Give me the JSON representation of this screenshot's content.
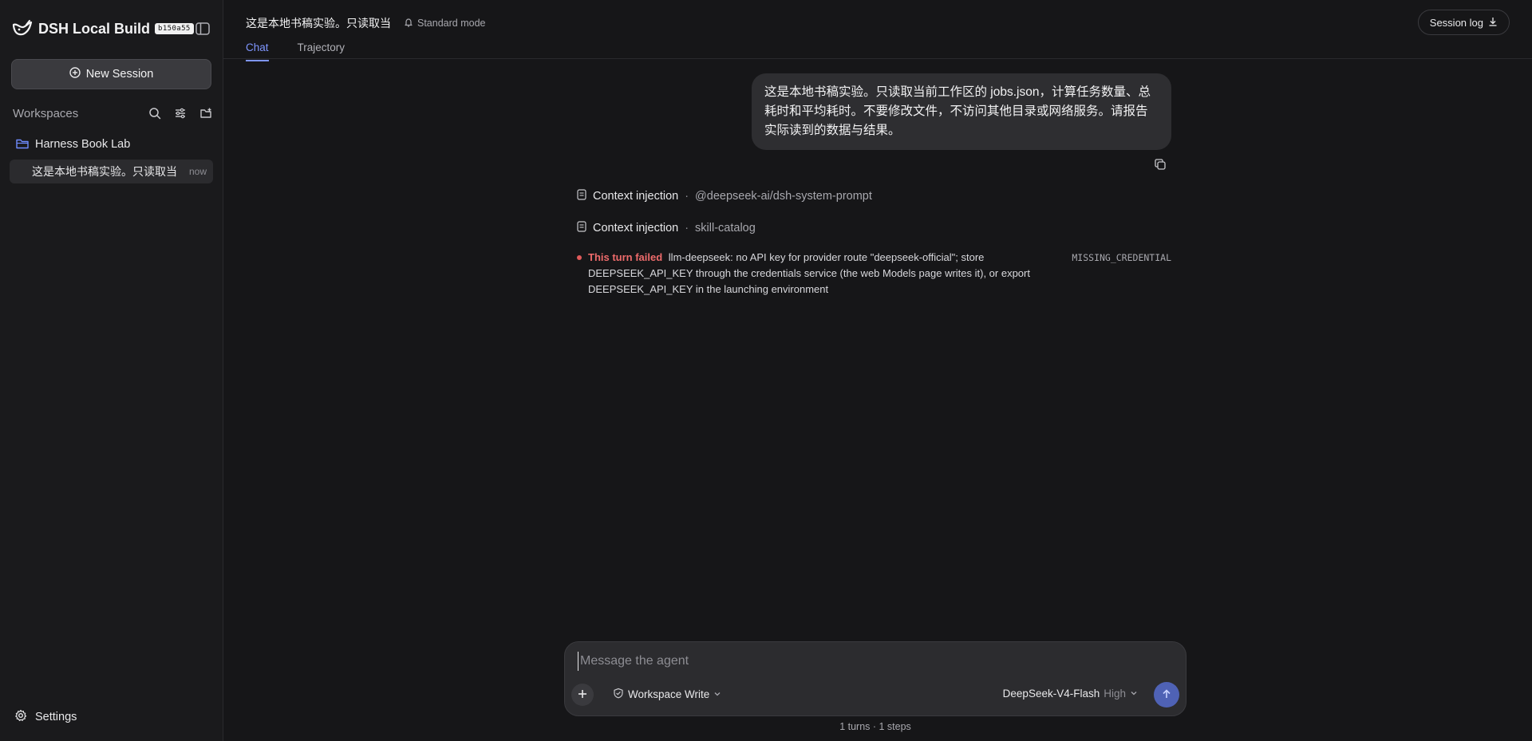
{
  "sidebar": {
    "brand_title": "DSH Local Build",
    "build_id": "b150a55",
    "new_session_label": "New Session",
    "workspaces_label": "Workspaces",
    "workspace": {
      "name": "Harness Book Lab",
      "sessions": [
        {
          "title": "这是本地书稿实验。只读取当",
          "time": "now"
        }
      ]
    },
    "settings_label": "Settings"
  },
  "header": {
    "title": "这是本地书稿实验。只读取当",
    "mode": "Standard mode",
    "tabs": [
      {
        "label": "Chat",
        "active": true
      },
      {
        "label": "Trajectory",
        "active": false
      }
    ],
    "session_log_label": "Session log"
  },
  "thread": {
    "user_message": "这是本地书稿实验。只读取当前工作区的 jobs.json，计算任务数量、总耗时和平均耗时。不要修改文件，不访问其他目录或网络服务。请报告实际读到的数据与结果。",
    "context_items": [
      {
        "label": "Context injection",
        "separator": "·",
        "value": "@deepseek-ai/dsh-system-prompt"
      },
      {
        "label": "Context injection",
        "separator": "·",
        "value": "skill-catalog"
      }
    ],
    "error": {
      "title": "This turn failed",
      "message": "llm-deepseek: no API key for provider route \"deepseek-official\"; store DEEPSEEK_API_KEY through the credentials service (the web Models page writes it), or export DEEPSEEK_API_KEY in the launching environment",
      "code": "MISSING_CREDENTIAL"
    }
  },
  "composer": {
    "placeholder": "Message the agent",
    "permission_label": "Workspace Write",
    "model_name": "DeepSeek-V4-Flash",
    "model_level": "High",
    "stats": "1 turns · 1 steps"
  }
}
